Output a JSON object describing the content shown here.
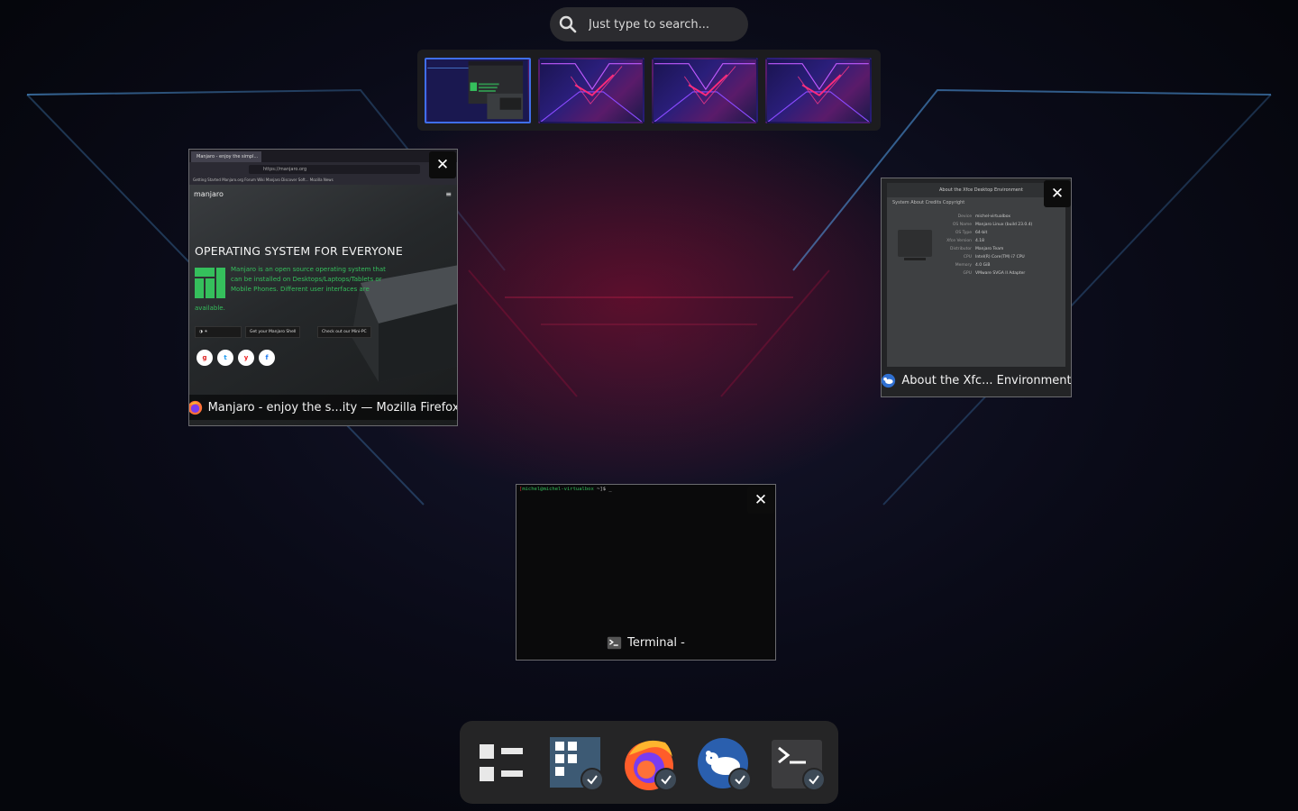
{
  "search": {
    "placeholder": "Just type to search..."
  },
  "workspaces": [
    {
      "label": "workspace-1",
      "active": true
    },
    {
      "label": "workspace-2",
      "active": false
    },
    {
      "label": "workspace-3",
      "active": false
    },
    {
      "label": "workspace-4",
      "active": false
    }
  ],
  "windows": {
    "firefox": {
      "title": "Manjaro - enjoy the s...ity — Mozilla Firefox",
      "tab_label": "Manjaro - enjoy the simpl...",
      "url": "https://manjaro.org",
      "bookmarks": "Getting Started   Manjaro.org   Forum   Wiki   Manjaro Discover Soft...   Mozilla News",
      "page_brand": "manjaro",
      "headline": "OPERATING SYSTEM FOR EVERYONE",
      "body_text": "Manjaro is an open source operating system that can be installed on Desktops/Laptops/Tablets or Mobile Phones. Different user interfaces are",
      "body_text_tail": "available.",
      "buttons": [
        "Get your Manjaro Shell",
        "Check out our Mini-PC"
      ],
      "social": [
        "g",
        "t",
        "y",
        "f"
      ]
    },
    "about": {
      "title": "About the Xfc... Environment",
      "header": "About the Xfce Desktop Environment",
      "tabs": "System   About   Credits   Copyright",
      "rows": [
        {
          "k": "Device",
          "v": "michel-virtualbox"
        },
        {
          "k": "OS Name",
          "v": "Manjaro Linux (build 23.0.4)"
        },
        {
          "k": "OS Type",
          "v": "64-bit"
        },
        {
          "k": "Xfce Version",
          "v": "4.18"
        },
        {
          "k": "Distributor",
          "v": "Manjaro Team"
        },
        {
          "k": "CPU",
          "v": "Intel(R) Core(TM) i7 CPU"
        },
        {
          "k": "Memory",
          "v": "4.0 GiB"
        },
        {
          "k": "GPU",
          "v": "VMware SVGA II Adapter"
        }
      ]
    },
    "terminal": {
      "title": "Terminal -",
      "prompt_user": "michel@michel-virtualbox",
      "prompt_rest": " ~]$ _"
    }
  },
  "dock": {
    "items": [
      "show-apps",
      "window-manager",
      "firefox",
      "xfce-about",
      "terminal"
    ]
  },
  "colors": {
    "accent": "#3f6ee8",
    "manjaro_green": "#35bf5c",
    "dock_bg": "#252526",
    "check_bg": "#3d4a57"
  }
}
